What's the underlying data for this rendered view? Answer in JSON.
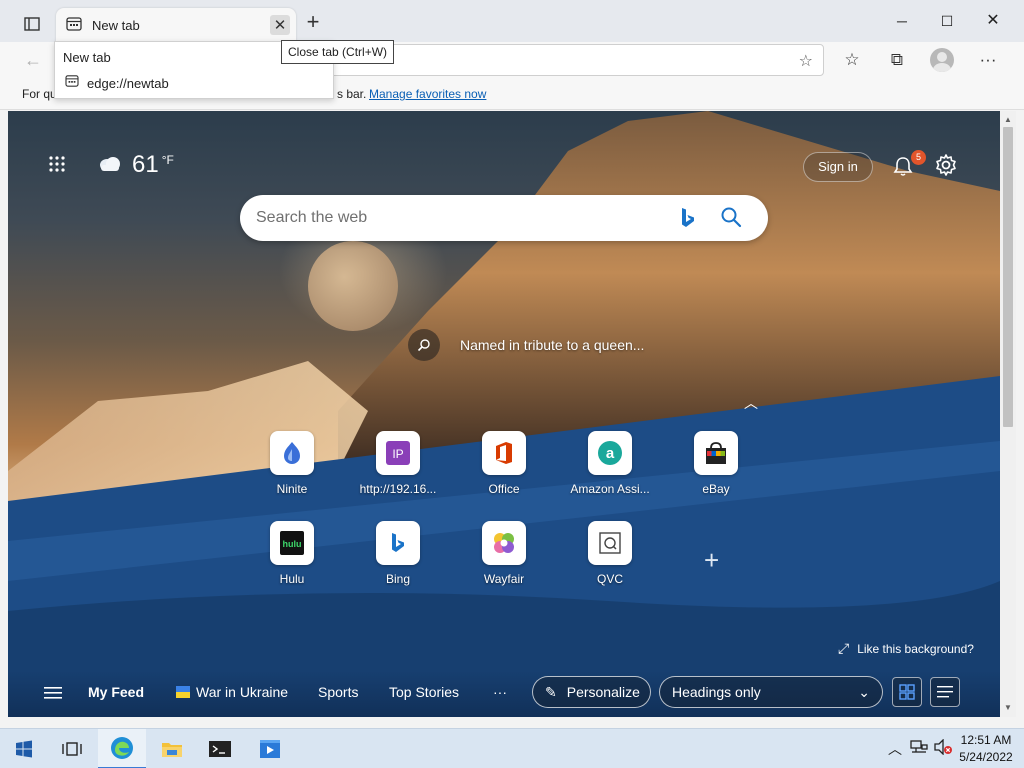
{
  "browser": {
    "tab_title": "New tab",
    "tab_dropdown_title": "New tab",
    "tab_dropdown_url": "edge://newtab",
    "close_tooltip": "Close tab (Ctrl+W)",
    "favorites_text_left": "For qu",
    "favorites_text_right": "s bar.",
    "favorites_link": "Manage favorites now"
  },
  "newtab": {
    "temperature": "61",
    "temp_unit": "°F",
    "sign_in": "Sign in",
    "notification_count": "5",
    "search_placeholder": "Search the web",
    "caption": "Named in tribute to a queen...",
    "like_background": "Like this background?",
    "tiles": [
      {
        "label": "Ninite"
      },
      {
        "label": "http://192.16..."
      },
      {
        "label": "Office"
      },
      {
        "label": "Amazon Assi..."
      },
      {
        "label": "eBay"
      },
      {
        "label": "Hulu"
      },
      {
        "label": "Bing"
      },
      {
        "label": "Wayfair"
      },
      {
        "label": "QVC"
      }
    ],
    "feed": {
      "my_feed": "My Feed",
      "ukraine": "War in Ukraine",
      "sports": "Sports",
      "top_stories": "Top Stories",
      "more": "···",
      "personalize": "Personalize",
      "layout": "Headings only"
    }
  },
  "taskbar": {
    "time": "12:51 AM",
    "date": "5/24/2022"
  },
  "colors": {
    "link": "#0a5fb4",
    "badge": "#e2552b",
    "bing_blue": "#1a73c8"
  }
}
